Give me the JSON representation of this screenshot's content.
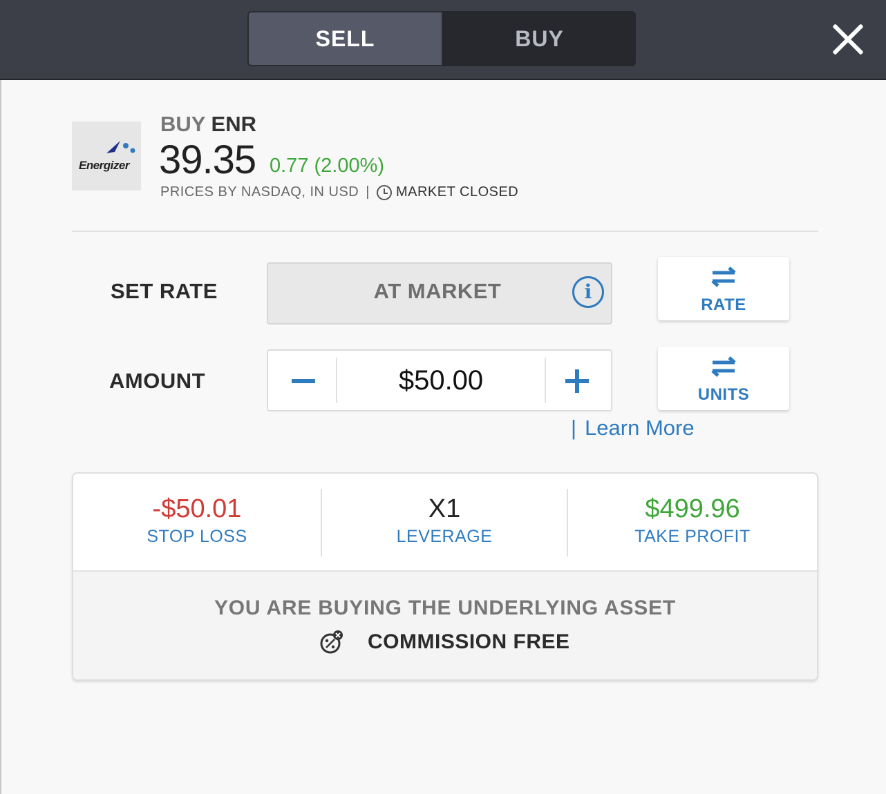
{
  "tabs": {
    "sell": "SELL",
    "buy": "BUY",
    "active": "sell"
  },
  "asset": {
    "action": "BUY",
    "symbol": "ENR",
    "logo_text": "Energizer",
    "price": "39.35",
    "change": "0.77 (2.00%)",
    "source": "PRICES BY NASDAQ, IN USD",
    "separator": "|",
    "market_status": "MARKET CLOSED"
  },
  "rate": {
    "label": "SET RATE",
    "value": "AT MARKET",
    "info_glyph": "i",
    "toggle_label": "RATE"
  },
  "amount": {
    "label": "AMOUNT",
    "value": "$50.00",
    "toggle_label": "UNITS"
  },
  "learn_more": {
    "bar": "|",
    "text": "Learn More"
  },
  "stats": {
    "stop_loss": {
      "value": "-$50.01",
      "label": "STOP LOSS"
    },
    "leverage": {
      "value": "X1",
      "label": "LEVERAGE"
    },
    "take_profit": {
      "value": "$499.96",
      "label": "TAKE PROFIT"
    }
  },
  "notice": {
    "line": "YOU ARE BUYING THE UNDERLYING ASSET",
    "commission": "COMMISSION FREE"
  },
  "icons": {
    "close": "close-icon",
    "clock": "clock-icon",
    "info": "info-icon",
    "swap": "swap-arrows-icon",
    "minus": "minus-icon",
    "plus": "plus-icon",
    "commission": "commission-free-icon"
  },
  "colors": {
    "accent": "#2f7bbf",
    "positive": "#3fa63a",
    "negative": "#d03b35",
    "topbar": "#3c3f48"
  }
}
